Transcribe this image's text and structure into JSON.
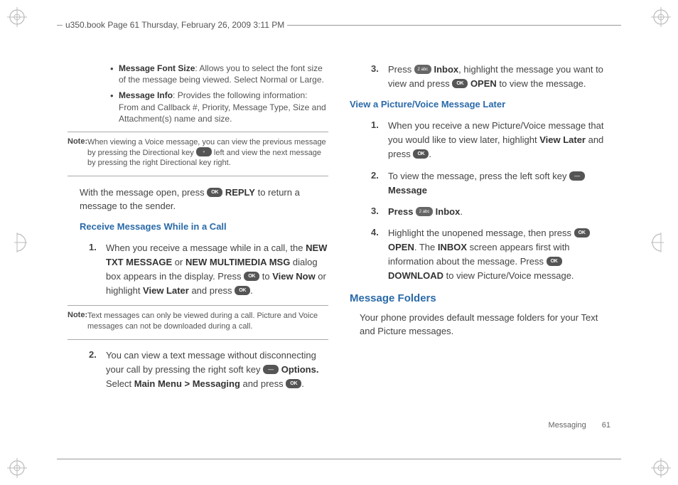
{
  "header": {
    "text": "u350.book  Page 61  Thursday, February 26, 2009  3:11 PM"
  },
  "left": {
    "bullets": [
      {
        "label": "Message Font Size",
        "rest": ": Allows you to select the font size of the message being viewed. Select Normal or Large."
      },
      {
        "label": "Message Info",
        "rest": ": Provides the following information: From and Callback #, Priority, Message Type, Size and Attachment(s) name and size."
      }
    ],
    "note1": {
      "label": "Note:",
      "text": "When viewing a Voice message, you can view the previous message by pressing the Directional key ",
      "after": " left and view the next message by pressing the right Directional key right."
    },
    "body1": {
      "pre": "With the message open, press ",
      "mid": " REPLY",
      "post": " to return a message to the sender."
    },
    "sub1": "Receive Messages While in a Call",
    "n1": {
      "a": "When you receive a message while in a call, the ",
      "b": "NEW TXT MESSAGE",
      "c": " or ",
      "d": "NEW MULTIMEDIA MSG",
      "e": " dialog box appears in the display. Press ",
      "f": " to ",
      "g": "View Now",
      "h": " or highlight ",
      "i": "View Later",
      "j": " and press ",
      "k": "."
    },
    "note2": {
      "label": "Note:",
      "text": "Text messages can only be viewed during a call. Picture and Voice messages can not be downloaded during a call."
    },
    "n2": {
      "a": "You can view a text message without disconnecting your call by pressing the right soft key ",
      "b": " Options.",
      "c": " Select ",
      "d": "Main Menu > Messaging",
      "e": " and press ",
      "f": "."
    }
  },
  "right": {
    "n3": {
      "a": "Press ",
      "b": " Inbox",
      "c": ", highlight the message you want to view and press ",
      "d": " OPEN",
      "e": " to view the message."
    },
    "sub2": "View a Picture/Voice Message Later",
    "n1": {
      "a": "When you receive a new Picture/Voice message that you would like to view later, highlight ",
      "b": "View Later",
      "c": " and press ",
      "d": "."
    },
    "n2": {
      "a": "To view the message, press the left soft key ",
      "b": " Message"
    },
    "n3b": {
      "a": "Press ",
      "b": " Inbox",
      "c": "."
    },
    "n4": {
      "a": "Highlight the unopened message, then press ",
      "b": " OPEN",
      "c": ". The ",
      "d": "INBOX",
      "e": " screen appears first with information about the message. Press ",
      "f": " DOWNLOAD",
      "g": " to view Picture/Voice message."
    },
    "section": "Message Folders",
    "sectbody": "Your phone provides default message folders for your Text and Picture messages."
  },
  "footer": {
    "label": "Messaging",
    "page": "61"
  }
}
